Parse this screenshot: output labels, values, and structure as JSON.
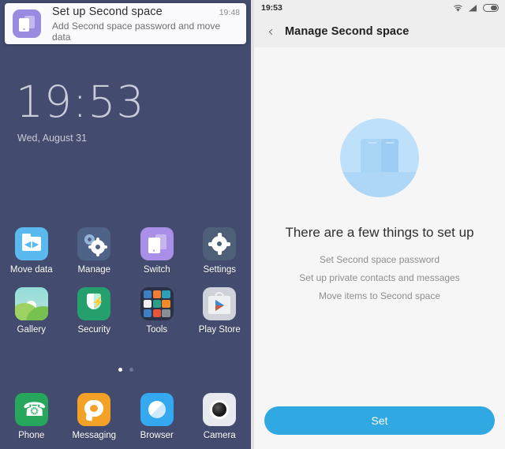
{
  "left_panel": {
    "notification": {
      "icon": "second-space-icon",
      "title": "Set up Second space",
      "time": "19:48",
      "subtitle": "Add Second space password and move data"
    },
    "lockscreen": {
      "clock": "19:53",
      "date": "Wed, August 31"
    },
    "apps": [
      [
        {
          "label": "Move data",
          "icon": "move-data-icon",
          "color": "#5ab9ee"
        },
        {
          "label": "Manage",
          "icon": "manage-icon",
          "color": "#4e6387"
        },
        {
          "label": "Switch",
          "icon": "switch-icon",
          "color": "#a98fe8"
        },
        {
          "label": "Settings",
          "icon": "settings-gear-icon",
          "color": "#4d6077"
        }
      ],
      [
        {
          "label": "Gallery",
          "icon": "gallery-icon",
          "color": "#8cd7d3"
        },
        {
          "label": "Security",
          "icon": "security-shield-icon",
          "color": "#25a06c"
        },
        {
          "label": "Tools",
          "icon": "tools-folder-icon",
          "color": "#2a3045"
        },
        {
          "label": "Play Store",
          "icon": "play-store-icon",
          "color": "#cfd2d8"
        }
      ]
    ],
    "dock": [
      {
        "label": "Phone",
        "icon": "phone-icon",
        "color": "#27a75c"
      },
      {
        "label": "Messaging",
        "icon": "messaging-icon",
        "color": "#f4a227"
      },
      {
        "label": "Browser",
        "icon": "browser-icon",
        "color": "#35a9ef"
      },
      {
        "label": "Camera",
        "icon": "camera-icon",
        "color": "#e8eaef"
      }
    ],
    "page_indicator": {
      "pages": 2,
      "active": 1
    },
    "tools_folder_colors": [
      "#3d7fc4",
      "#f07d32",
      "#2f9fb5",
      "#f0f0f0",
      "#2aa08a",
      "#ef8a2a",
      "#3d7fc4",
      "#e8553c",
      "#8a8f96"
    ],
    "background_color": "#434b6e"
  },
  "right_panel": {
    "statusbar": {
      "time": "19:53",
      "icons": [
        "wifi-icon",
        "signal-icon",
        "battery-icon"
      ]
    },
    "appbar": {
      "back_icon": "back-chevron-icon",
      "title": "Manage Second space"
    },
    "hero_icon": "second-space-illustration",
    "headline": "There are a few things to set up",
    "steps": [
      "Set Second space password",
      "Set up private contacts and messages",
      "Move items to Second space"
    ],
    "primary_button": {
      "label": "Set",
      "color": "#30a9e3"
    }
  }
}
